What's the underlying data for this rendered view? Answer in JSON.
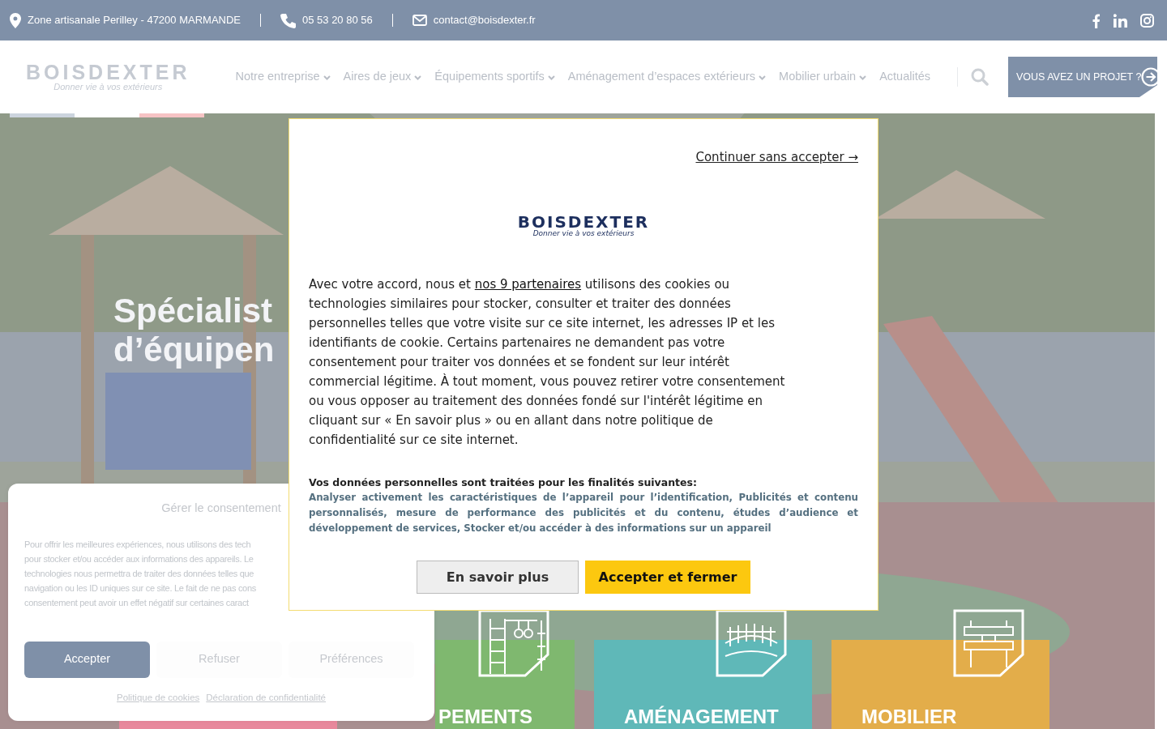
{
  "topbar": {
    "address": "Zone artisanale Perilley - 47200 MARMANDE",
    "phone": "05 53 20 80 56",
    "email": "contact@boisdexter.fr"
  },
  "header": {
    "logo": {
      "name": "BOISDEXTER",
      "tagline": "Donner vie à vos extérieurs"
    },
    "nav": [
      {
        "label": "Notre entreprise",
        "dropdown": true
      },
      {
        "label": "Aires de jeux",
        "dropdown": true
      },
      {
        "label": "Équipements sportifs",
        "dropdown": true
      },
      {
        "label": "Aménagement d’espaces extérieurs",
        "dropdown": true
      },
      {
        "label": "Mobilier urbain",
        "dropdown": true
      },
      {
        "label": "Actualités",
        "dropdown": false
      }
    ],
    "cta": "VOUS AVEZ UN PROJET ?"
  },
  "hero": {
    "title_lines": [
      "Spécialist",
      "d’équipen"
    ],
    "categories": [
      {
        "color": "#e8889c"
      },
      {
        "label": "PEMENTS",
        "color": "#7fb86f"
      },
      {
        "label": "AMÉNAGEMENT",
        "color": "#5fb8b8"
      },
      {
        "label": "MOBILIER",
        "color": "#e3ad4a"
      }
    ]
  },
  "cookie_panel": {
    "title": "Gérer le consentement",
    "lines": [
      "Pour offrir les meilleures expériences, nous utilisons des tech",
      "pour stocker et/ou accéder aux informations des appareils. Le",
      "technologies nous permettra de traiter des données telles que",
      "navigation ou les ID uniques sur ce site. Le fait de ne pas cons",
      "consentement peut avoir un effet négatif sur certaines caract"
    ],
    "buttons": [
      {
        "label": "Accepter",
        "primary": true
      },
      {
        "label": "Refuser",
        "primary": false
      },
      {
        "label": "Préférences",
        "primary": false
      }
    ],
    "links": [
      "Politique de cookies",
      "Déclaration de confidentialité"
    ]
  },
  "dialog": {
    "skip_link": "Continuer sans accepter →",
    "logo": {
      "name": "BOISDEXTER",
      "tagline": "Donner vie à vos extérieurs"
    },
    "intro_before": "Avec votre accord, nous et ",
    "partners_link": "nos 9 partenaires",
    "intro_after": " utilisons des cookies ou technologies similaires pour stocker, consulter et traiter des données personnelles telles que votre visite sur ce site internet, les adresses IP et les identifiants de cookie. Certains partenaires ne demandent pas votre consentement pour traiter vos données et se fondent sur leur intérêt commercial légitime. À tout moment, vous pouvez retirer votre consentement ou vous opposer au traitement des données fondé sur l'intérêt légitime en cliquant sur « En savoir plus » ou en allant dans notre politique de confidentialité sur ce site internet.",
    "purposes_title": "Vos données personnelles sont traitées pour les finalités suivantes:",
    "purposes": "Analyser activement les caractéristiques de l’appareil pour l’identification, Publicités et contenu personnalisés, mesure de performance des publicités et du contenu, études d’audience et développement de services, Stocker et/ou accéder à des informations sur un appareil",
    "buttons": [
      {
        "label": "En savoir plus",
        "primary": false
      },
      {
        "label": "Accepter et fermer",
        "primary": true
      }
    ]
  }
}
